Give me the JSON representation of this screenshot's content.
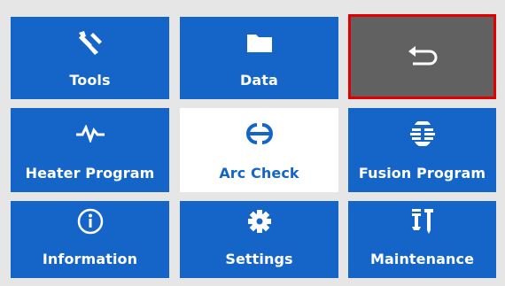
{
  "menu": {
    "tiles": [
      {
        "id": "tools",
        "label": "Tools",
        "icon": "tools-icon"
      },
      {
        "id": "data",
        "label": "Data",
        "icon": "folder-icon"
      },
      {
        "id": "back",
        "label": "",
        "icon": "return-arrow-icon"
      },
      {
        "id": "heater_program",
        "label": "Heater Program",
        "icon": "heater-wave-icon"
      },
      {
        "id": "arc_check",
        "label": "Arc Check",
        "icon": "arc-check-icon"
      },
      {
        "id": "fusion_program",
        "label": "Fusion Program",
        "icon": "fusion-icon"
      },
      {
        "id": "information",
        "label": "Information",
        "icon": "info-icon"
      },
      {
        "id": "settings",
        "label": "Settings",
        "icon": "gear-icon"
      },
      {
        "id": "maintenance",
        "label": "Maintenance",
        "icon": "maintenance-icon"
      }
    ],
    "selected": "arc_check",
    "focused": "back"
  },
  "colors": {
    "tile": "#1565c8",
    "selected_tile": "#ffffff",
    "back_tile": "#616161",
    "focus_border": "#e00000",
    "background": "#e6e6e6"
  }
}
